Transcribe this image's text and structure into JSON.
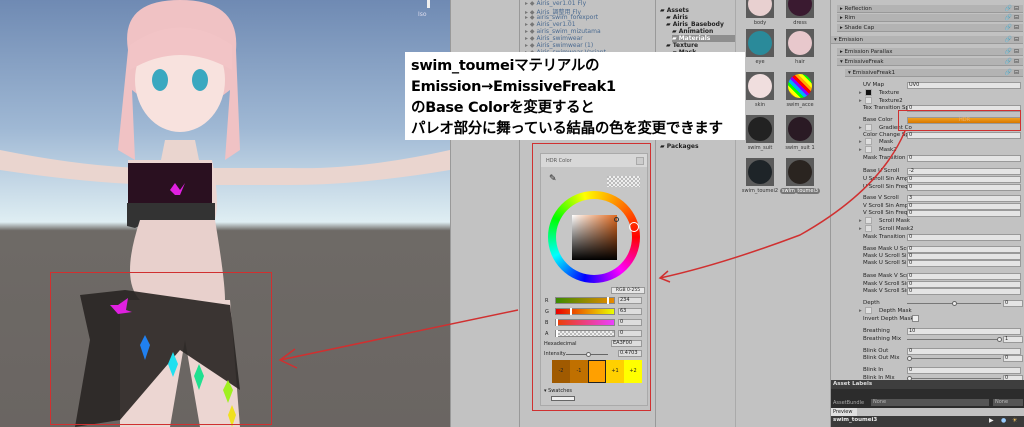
{
  "viewport": {
    "projection_label": "Iso"
  },
  "hierarchy": {
    "items": [
      "Airis_ver1.01 Fly",
      "Airis_調整用 Fly",
      "airis_swim_forexport",
      "Airis_ver1.01",
      "airis_swim_mizutama",
      "Airis_swimwear",
      "Airis_swimwear (1)",
      "Airis_swimwear Variant"
    ]
  },
  "project": {
    "folders": [
      {
        "label": "Assets",
        "selected": false
      },
      {
        "label": "Airis",
        "selected": false
      },
      {
        "label": "Airis_Basebody",
        "selected": false
      },
      {
        "label": "Animation",
        "selected": false
      },
      {
        "label": "Materials",
        "selected": true
      },
      {
        "label": "Texture",
        "selected": false
      },
      {
        "label": "Mask",
        "selected": false
      },
      {
        "label": "Packages",
        "selected": false
      }
    ],
    "assets": [
      {
        "label": "body",
        "color": "#e8d0d0"
      },
      {
        "label": "dress",
        "color": "#3a1a30"
      },
      {
        "label": "eye",
        "color": "#2a8a9a"
      },
      {
        "label": "hair",
        "color": "#e8c8cc"
      },
      {
        "label": "skin",
        "color": "#f0dede"
      },
      {
        "label": "swim_acce",
        "color": "#ff4488"
      },
      {
        "label": "swim_suit",
        "color": "#222222"
      },
      {
        "label": "swim_suit 1",
        "color": "#2a1a24"
      },
      {
        "label": "swim_toumei2",
        "color": "#1e2428"
      },
      {
        "label": "swim_toumei3",
        "color": "#2a2420"
      }
    ]
  },
  "annotation": {
    "lines": [
      "swim_toumeiマテリアルの",
      "Emission→EmissiveFreak1",
      "のBase Colorを変更すると",
      "パレオ部分に舞っている結晶の色を変更できます"
    ]
  },
  "color_picker": {
    "title": "HDR Color",
    "mode_button": "RGB 0-255",
    "channels": [
      {
        "label": "R",
        "value": "234"
      },
      {
        "label": "G",
        "value": "63"
      },
      {
        "label": "B",
        "value": "0"
      },
      {
        "label": "A",
        "value": "0"
      }
    ],
    "hex_label": "Hexadecimal",
    "hex_value": "EA3F00",
    "intensity_label": "Intensity",
    "intensity_value": "0.4703",
    "presets": [
      "-2",
      "-1",
      "0",
      "+1",
      "+2"
    ],
    "swatches_label": "Swatches",
    "color": "#ea9a00"
  },
  "inspector": {
    "rows": [
      {
        "kind": "hdr1",
        "label": "Reflection"
      },
      {
        "kind": "hdr1",
        "label": "Rim"
      },
      {
        "kind": "hdr1",
        "label": "Shade Cap"
      },
      {
        "kind": "hdr0",
        "label": "Emission"
      },
      {
        "kind": "hdr1",
        "label": "Emission Parallax"
      },
      {
        "kind": "hdr1",
        "label": "EmissiveFreak"
      },
      {
        "kind": "hdr2",
        "label": "EmissiveFreak1"
      },
      {
        "kind": "field",
        "label": "UV Map",
        "value": "UV0"
      },
      {
        "kind": "tex",
        "label": "Texture"
      },
      {
        "kind": "tex",
        "label": "Texture2"
      },
      {
        "kind": "field",
        "label": "Tex Transition Sp",
        "value": "0"
      },
      {
        "kind": "color",
        "label": "Base Color",
        "value": "HDR"
      },
      {
        "kind": "tex",
        "label": "Gradient Co"
      },
      {
        "kind": "field",
        "label": "Color Change Sp",
        "value": "0"
      },
      {
        "kind": "tex",
        "label": "Mask"
      },
      {
        "kind": "tex",
        "label": "Mask2"
      },
      {
        "kind": "field",
        "label": "Mask Transition S",
        "value": "0"
      },
      {
        "kind": "field",
        "label": "Base U Scroll",
        "value": "-2"
      },
      {
        "kind": "field",
        "label": "U Scroll Sin Amp",
        "value": "0"
      },
      {
        "kind": "field",
        "label": "U Scroll Sin Freq",
        "value": "0"
      },
      {
        "kind": "field",
        "label": "Base V Scroll",
        "value": "3"
      },
      {
        "kind": "field",
        "label": "V Scroll Sin Amp",
        "value": "0"
      },
      {
        "kind": "field",
        "label": "V Scroll Sin Freq",
        "value": "0"
      },
      {
        "kind": "tex",
        "label": "Scroll Mask"
      },
      {
        "kind": "tex",
        "label": "Scroll Mask2"
      },
      {
        "kind": "field",
        "label": "Mask Transition S",
        "value": "0"
      },
      {
        "kind": "field",
        "label": "Base Mask U Scro",
        "value": "0"
      },
      {
        "kind": "field",
        "label": "Mask U Scroll Sin",
        "value": "0"
      },
      {
        "kind": "field",
        "label": "Mask U Scroll Sin",
        "value": "0"
      },
      {
        "kind": "field",
        "label": "Base Mask V Scro",
        "value": "0"
      },
      {
        "kind": "field",
        "label": "Mask V Scroll Sin",
        "value": "0"
      },
      {
        "kind": "field",
        "label": "Mask V Scroll Sin",
        "value": "0"
      },
      {
        "kind": "slider",
        "label": "Depth",
        "value": "0",
        "fraction": 0.5
      },
      {
        "kind": "tex",
        "label": "Depth Mask"
      },
      {
        "kind": "check",
        "label": "Invert Depth Mask"
      },
      {
        "kind": "field",
        "label": "Breathing",
        "value": "10"
      },
      {
        "kind": "slider",
        "label": "Breathing Mix",
        "value": "1",
        "fraction": 1
      },
      {
        "kind": "field",
        "label": "Blink Out",
        "value": "0"
      },
      {
        "kind": "slider",
        "label": "Blink Out Mix",
        "value": "0",
        "fraction": 0
      },
      {
        "kind": "field",
        "label": "Blink In",
        "value": "0"
      },
      {
        "kind": "slider",
        "label": "Blink In Mix",
        "value": "0",
        "fraction": 0
      }
    ],
    "asset_labels": "Asset Labels",
    "assetbundle_label": "AssetBundle",
    "assetbundle_value": "None",
    "assetbundle_variant": "None",
    "preview_tab": "Preview",
    "preview_name": "swim_toumei3"
  }
}
